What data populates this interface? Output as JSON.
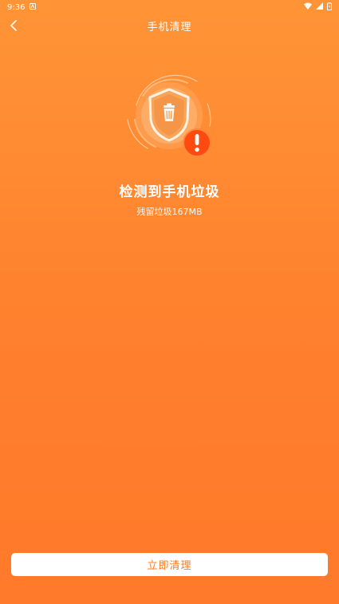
{
  "status_bar": {
    "time": "9:36",
    "icons": [
      "notification-icon",
      "wifi-icon",
      "signal-icon",
      "battery-icon"
    ]
  },
  "header": {
    "back_icon": "chevron-left-icon",
    "title": "手机清理"
  },
  "main": {
    "illustration_icon": "shield-trash-icon",
    "warning_icon": "exclamation-icon",
    "headline": "检测到手机垃圾",
    "detail": "残留垃圾167MB"
  },
  "footer": {
    "clean_button_label": "立即清理"
  },
  "colors": {
    "background_top": "#FF9436",
    "background_bottom": "#FF7A2A",
    "warning_badge": "#FF4A12",
    "button_text": "#FF7A22"
  }
}
